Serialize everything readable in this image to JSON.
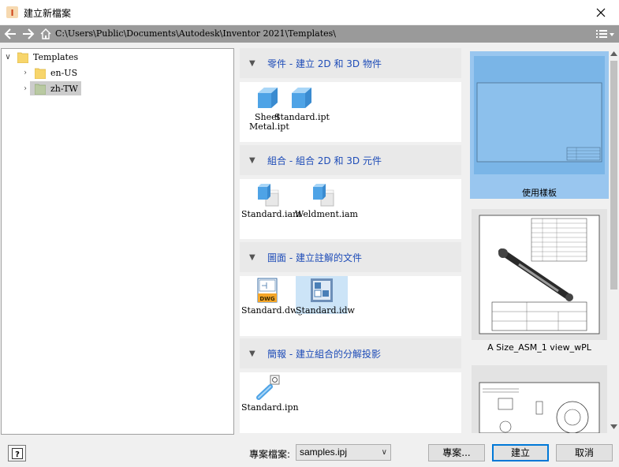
{
  "window": {
    "title": "建立新檔案",
    "close_icon": "close-icon"
  },
  "pathbar": {
    "path": "C:\\Users\\Public\\Documents\\Autodesk\\Inventor 2021\\Templates\\"
  },
  "tree": {
    "root": "Templates",
    "children": [
      {
        "label": "en-US"
      },
      {
        "label": "zh-TW"
      }
    ]
  },
  "categories": [
    {
      "title": "零件 - 建立 2D 和 3D 物件",
      "items": [
        "Sheet Metal.ipt",
        "Standard.ipt"
      ]
    },
    {
      "title": "組合 - 組合 2D 和 3D 元件",
      "items": [
        "Standard.iam",
        "Weldment.iam"
      ]
    },
    {
      "title": "圖面 - 建立註解的文件",
      "items": [
        "Standard.dwg",
        "Standard.idw"
      ]
    },
    {
      "title": "簡報 - 建立組合的分解投影",
      "items": [
        "Standard.ipn"
      ]
    }
  ],
  "dwg_badge": "DWG",
  "previews": [
    {
      "label": "使用樣板"
    },
    {
      "label": "A Size_ASM_1 view_wPL"
    }
  ],
  "bottom": {
    "project_label": "專案檔案:",
    "project_value": "samples.ipj",
    "projects_button": "專案...",
    "create_button": "建立",
    "cancel_button": "取消"
  },
  "colors": {
    "accent": "#0078d7",
    "category_title": "#1f4db8",
    "selected_preview": "#99c6ef",
    "pathbar": "#9a9a9a"
  }
}
